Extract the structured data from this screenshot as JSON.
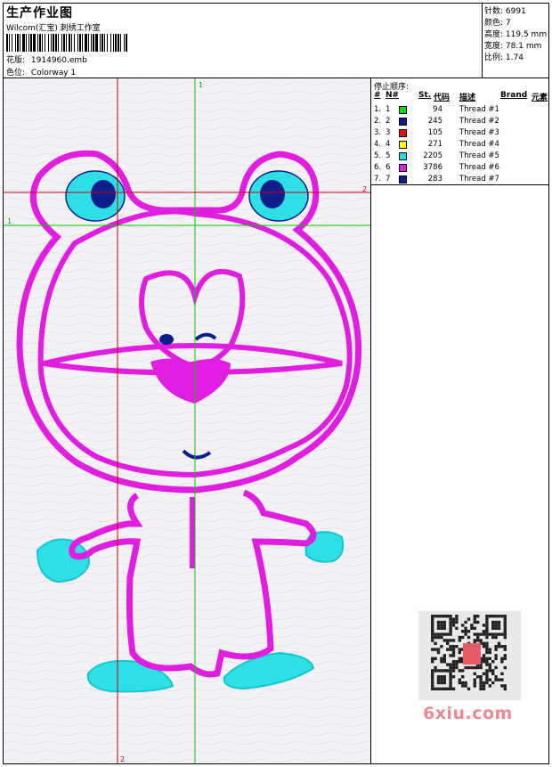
{
  "header": {
    "title": "生产作业图",
    "subtitle": "Wilcom(汇宝) 刺绣工作室",
    "design_file_label": "花版:",
    "design_file": "1914960.emb",
    "colorway_label": "色位:",
    "colorway": "Colorway 1"
  },
  "stats": [
    {
      "label": "针数:",
      "value": "6991"
    },
    {
      "label": "颜色:",
      "value": "7"
    },
    {
      "label": "高度:",
      "value": "119.5 mm"
    },
    {
      "label": "宽度:",
      "value": "78.1 mm"
    },
    {
      "label": "比例:",
      "value": "1.74"
    }
  ],
  "guides": {
    "v_red": "2",
    "v_green": "1",
    "h_red": "2",
    "h_green": "1",
    "v_red_bottom": "2"
  },
  "stop_sequence": {
    "title": "停止顺序:",
    "columns": [
      "#",
      "N#",
      "St.",
      "代码",
      "描述",
      "Brand",
      "元素"
    ],
    "rows": [
      {
        "idx": "1.",
        "n": "1",
        "color": "#00e000",
        "st": "94",
        "desc": "Thread #1"
      },
      {
        "idx": "2.",
        "n": "2",
        "color": "#0b1f8c",
        "st": "245",
        "desc": "Thread #2"
      },
      {
        "idx": "3.",
        "n": "3",
        "color": "#e01010",
        "st": "105",
        "desc": "Thread #3"
      },
      {
        "idx": "4.",
        "n": "4",
        "color": "#ffff00",
        "st": "271",
        "desc": "Thread #4"
      },
      {
        "idx": "5.",
        "n": "5",
        "color": "#20dede",
        "st": "2205",
        "desc": "Thread #5"
      },
      {
        "idx": "6.",
        "n": "6",
        "color": "#e020e0",
        "st": "3786",
        "desc": "Thread #6"
      },
      {
        "idx": "7.",
        "n": "7",
        "color": "#0b1f8c",
        "st": "283",
        "desc": "Thread #7"
      }
    ]
  },
  "watermark": "6xiu.com",
  "colors": {
    "magenta": "#e01ee0",
    "cyan": "#2ee0e6",
    "navy": "#0b1f8c",
    "guide_red": "#cc0000",
    "guide_green": "#00cc00"
  }
}
